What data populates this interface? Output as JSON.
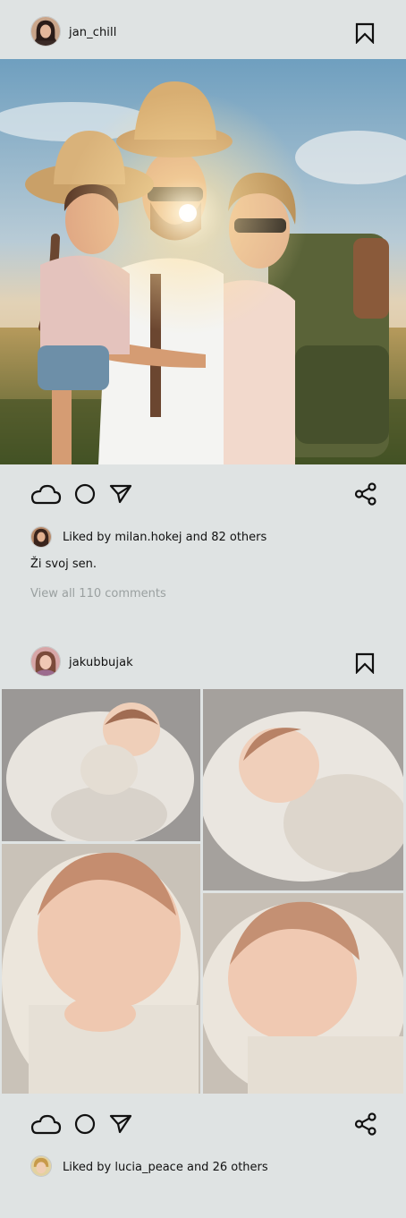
{
  "colors": {
    "background": "#dfe3e3",
    "text": "#111111",
    "muted": "#9aa0a0"
  },
  "posts": [
    {
      "username": "jan_chill",
      "image": "family-travel-photo",
      "liked_by_prefix": "Liked by ",
      "liked_by_user": "milan.hokej",
      "liked_by_suffix": " and 82 others",
      "caption": "Ži svoj sen.",
      "view_comments": "View all 110 comments"
    },
    {
      "username": "jakubbujak",
      "images": [
        "newborn-photo-1",
        "newborn-photo-2",
        "newborn-photo-3",
        "newborn-photo-4"
      ],
      "liked_by_prefix": "Liked by ",
      "liked_by_user": "lucia_peace",
      "liked_by_suffix": " and 26 others"
    }
  ],
  "icons": [
    "cloud-icon",
    "circle-icon",
    "send-icon",
    "share-icon",
    "bookmark-icon"
  ]
}
